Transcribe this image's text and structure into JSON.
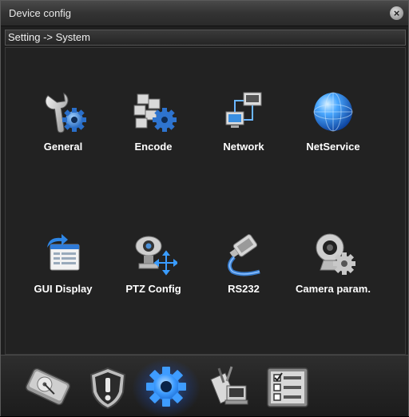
{
  "window": {
    "title": "Device config",
    "close_icon": "close-icon"
  },
  "breadcrumb": "Setting -> System",
  "items": [
    {
      "label": "General",
      "icon": "wrench-gear-icon"
    },
    {
      "label": "Encode",
      "icon": "blocks-gear-icon"
    },
    {
      "label": "Network",
      "icon": "network-computers-icon"
    },
    {
      "label": "NetService",
      "icon": "globe-icon"
    },
    {
      "label": "GUI Display",
      "icon": "gui-display-icon"
    },
    {
      "label": "PTZ Config",
      "icon": "ptz-camera-icon"
    },
    {
      "label": "RS232",
      "icon": "serial-cable-icon"
    },
    {
      "label": "Camera param.",
      "icon": "webcam-gear-icon"
    }
  ],
  "bottom_bar": [
    {
      "icon": "hard-disk-icon"
    },
    {
      "icon": "alarm-shield-icon"
    },
    {
      "icon": "system-gear-icon",
      "active": true
    },
    {
      "icon": "management-tools-icon"
    },
    {
      "icon": "info-checklist-icon"
    }
  ],
  "colors": {
    "background": "#1f1f1f",
    "accent_blue": "#2f8cff",
    "label_text": "#ffffff"
  }
}
